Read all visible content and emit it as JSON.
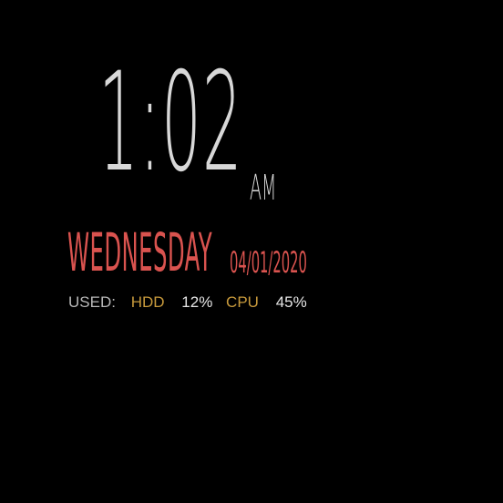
{
  "clock": {
    "time": "1:02",
    "meridiem": "AM"
  },
  "date": {
    "weekday": "WEDNESDAY",
    "date": "04/01/2020"
  },
  "usage": {
    "label": "USED:",
    "hdd_label": "HDD",
    "hdd_value": "12%",
    "cpu_label": "CPU",
    "cpu_value": "45%"
  },
  "colors": {
    "background": "#000000",
    "clock": "#d8d8d8",
    "date": "#d9534f",
    "metric_key": "#c89a3c",
    "metric_value": "#e6e6e6",
    "label": "#b8b8b8"
  }
}
